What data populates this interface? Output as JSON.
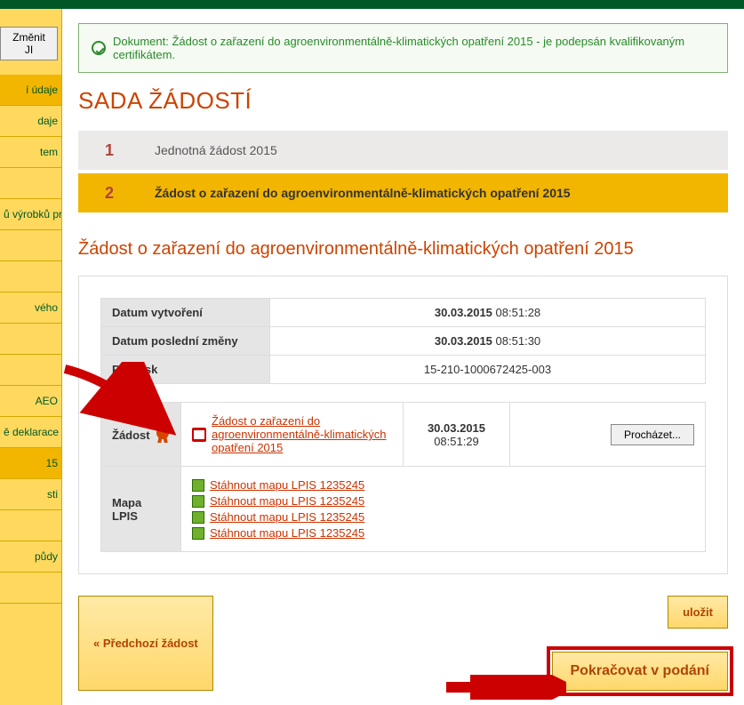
{
  "sidebar": {
    "button": "Změnit JI",
    "items": [
      {
        "label": "í údaje",
        "selected": true
      },
      {
        "label": "daje"
      },
      {
        "label": "tem"
      },
      {
        "label": ""
      },
      {
        "label": "ů výrobků pro"
      },
      {
        "label": ""
      },
      {
        "label": ""
      },
      {
        "label": "vého"
      },
      {
        "label": ""
      },
      {
        "label": ""
      },
      {
        "label": " AEO"
      },
      {
        "label": "ě deklarace\nosti AEO pro"
      },
      {
        "label": "15",
        "selected": true
      },
      {
        "label": "sti"
      },
      {
        "label": ""
      },
      {
        "label": " půdy"
      },
      {
        "label": ""
      }
    ]
  },
  "alert": {
    "text": "Dokument: Žádost o zařazení do agroenvironmentálně-klimatických opatření 2015 - je podepsán kvalifikovaným certifikátem."
  },
  "title": "SADA ŽÁDOSTÍ",
  "steps": [
    {
      "num": "1",
      "label": "Jednotná žádost 2015"
    },
    {
      "num": "2",
      "label": "Žádost o zařazení do agroenvironmentálně-klimatických opatření 2015"
    }
  ],
  "subtitle": "Žádost o zařazení do agroenvironmentálně-klimatických opatření 2015",
  "meta": [
    {
      "k": "Datum vytvoření",
      "date": "30.03.2015",
      "time": "08:51:28"
    },
    {
      "k": "Datum poslední změny",
      "date": "30.03.2015",
      "time": "08:51:30"
    },
    {
      "k": "Předtisk",
      "v": "15-210-1000672425-003"
    }
  ],
  "doc": {
    "rowlabel": "Žádost",
    "link": "Žádost o zařazení do agroenvironmentálně-klimatických opatření 2015",
    "date": "30.03.2015",
    "time": "08:51:29",
    "browse": "Procházet..."
  },
  "maps": {
    "rowlabel": "Mapa LPIS",
    "links": [
      "Stáhnout mapu LPIS 1235245",
      "Stáhnout mapu LPIS 1235245",
      "Stáhnout mapu LPIS 1235245",
      "Stáhnout mapu LPIS 1235245"
    ]
  },
  "footer": {
    "prev": "« Předchozí žádost",
    "save": "uložit",
    "continue": "Pokračovat v podání"
  }
}
